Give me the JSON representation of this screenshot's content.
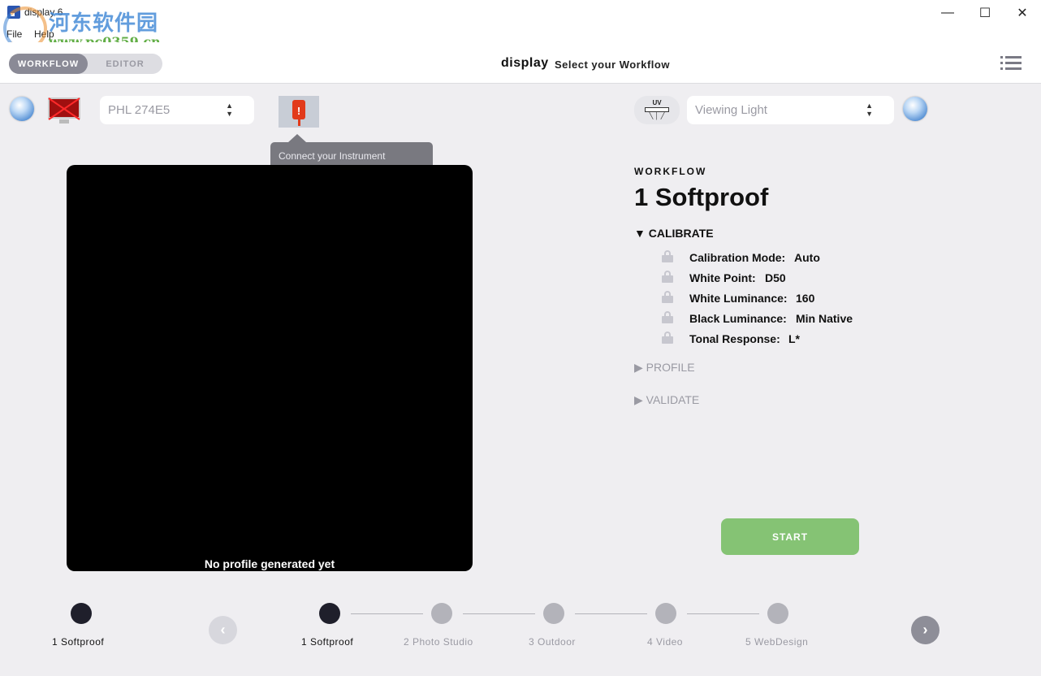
{
  "window": {
    "title": "display 6",
    "minimize_glyph": "—",
    "maximize_glyph": "☐",
    "close_glyph": "✕"
  },
  "watermark": {
    "title": "河东软件园",
    "url": "www.pc0359.cn"
  },
  "menu": {
    "items": [
      "File",
      "Help"
    ]
  },
  "header": {
    "modes": {
      "workflow": "WORKFLOW",
      "editor": "EDITOR"
    },
    "active_mode": "workflow",
    "brand": "display",
    "subtitle": "Select your Workflow"
  },
  "toolbar": {
    "display_select": {
      "value": "PHL 274E5"
    },
    "instrument_tooltip": "Connect your Instrument",
    "uv_label": "UV",
    "light_select": {
      "value": "Viewing Light"
    },
    "select_arrows": "▲▼"
  },
  "preview": {
    "caption": "No profile generated yet"
  },
  "panel": {
    "label": "WORKFLOW",
    "title": "1 Softproof",
    "calibrate_label": "▼ CALIBRATE",
    "settings": [
      {
        "label": "Calibration Mode:",
        "value": "Auto"
      },
      {
        "label": "White Point:",
        "value": "D50"
      },
      {
        "label": "White Luminance:",
        "value": "160"
      },
      {
        "label": "Black Luminance:",
        "value": "Min Native"
      },
      {
        "label": "Tonal Response:",
        "value": "L*"
      }
    ],
    "profile_label": "▶ PROFILE",
    "validate_label": "▶ VALIDATE",
    "start_label": "START"
  },
  "footer": {
    "current": "1 Softproof",
    "prev_glyph": "‹",
    "next_glyph": "›",
    "steps": [
      "1 Softproof",
      "2 Photo Studio",
      "3 Outdoor",
      "4 Video",
      "5 WebDesign"
    ],
    "active_step": 0
  },
  "colors": {
    "start_button": "#85c374",
    "usb_alert": "#e23a1a",
    "active_dot": "#1f1f2b",
    "inactive_dot": "#b3b3ba"
  }
}
